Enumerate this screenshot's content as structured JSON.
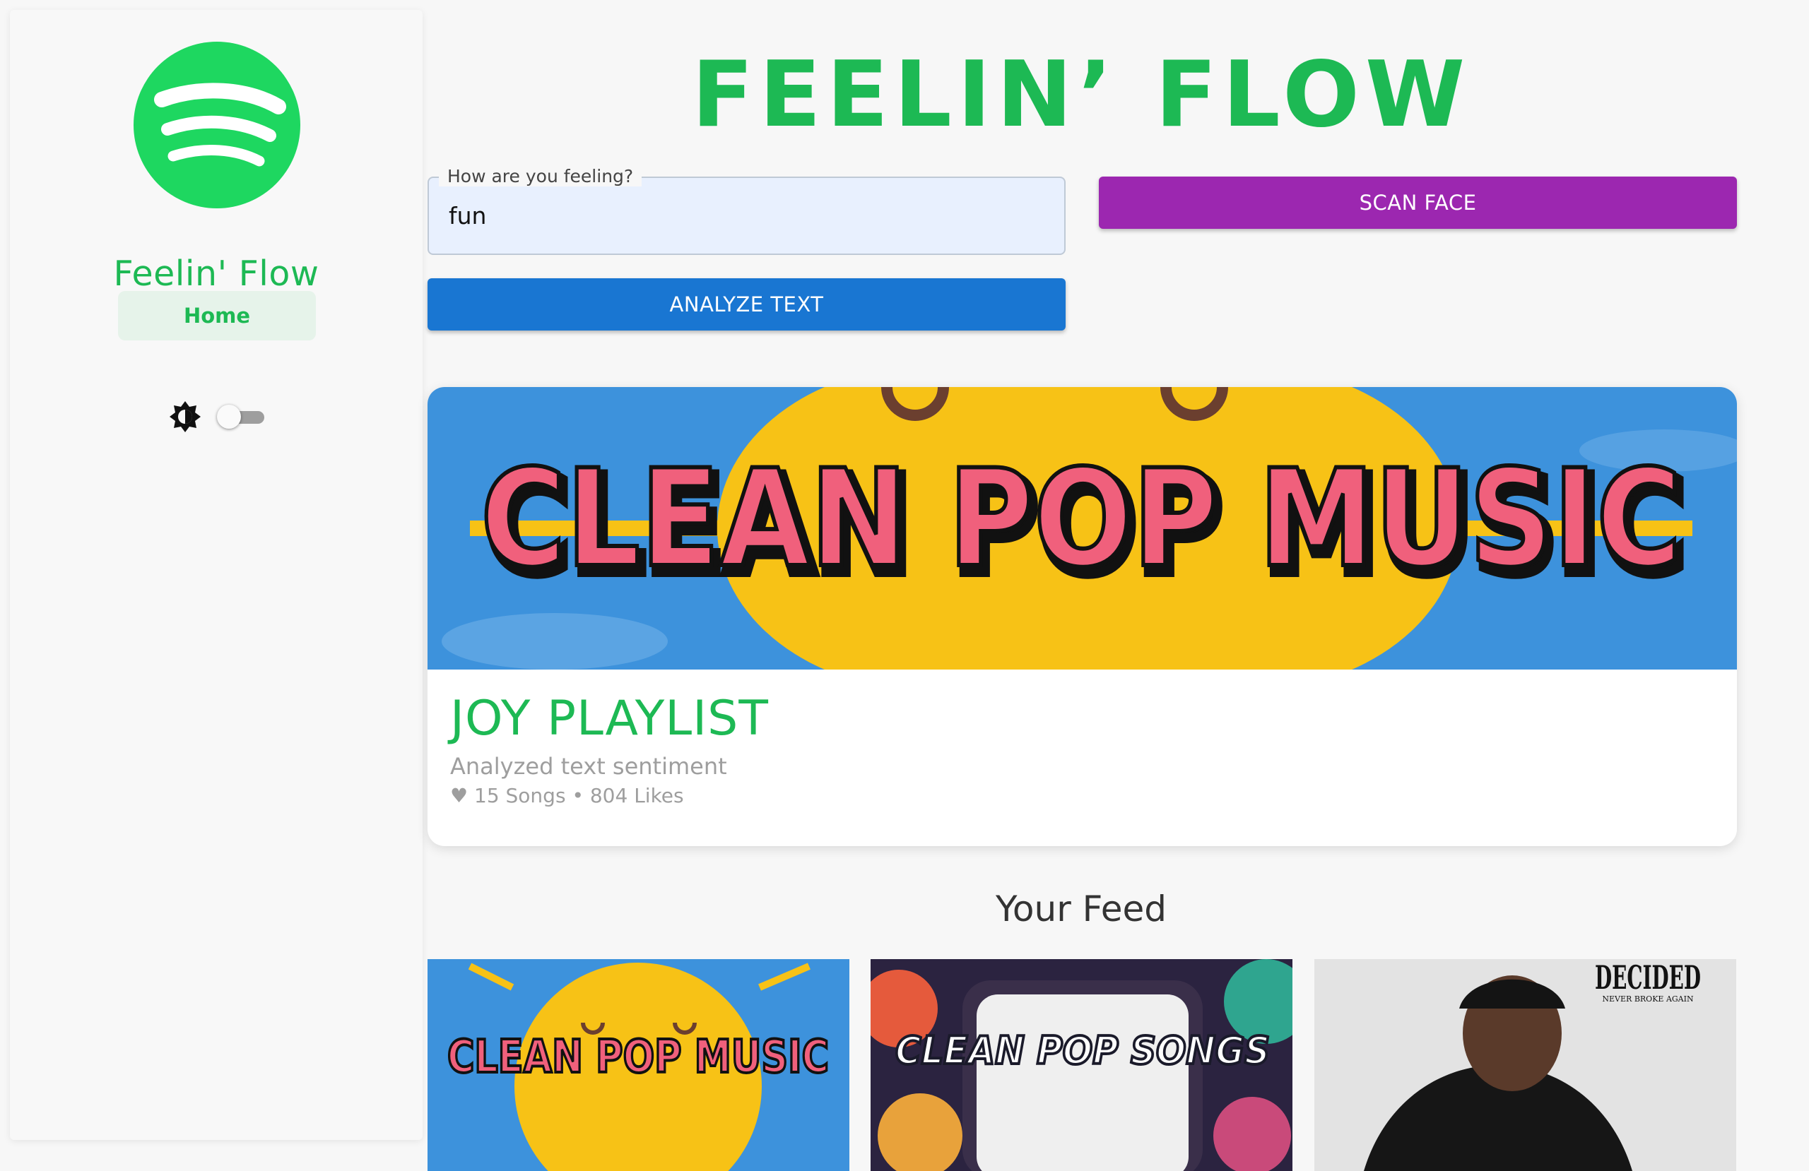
{
  "sidebar": {
    "app_name": "Feelin' Flow",
    "nav": [
      {
        "label": "Home",
        "active": true
      }
    ],
    "theme_toggle": {
      "icon": "brightness-icon",
      "enabled": false
    }
  },
  "header": {
    "title": "FEELIN’ FLOW"
  },
  "mood_form": {
    "field_label": "How are you feeling?",
    "field_value": "fun",
    "analyze_label": "ANALYZE TEXT",
    "scan_label": "SCAN FACE"
  },
  "playlist_card": {
    "banner_text": "CLEAN POP MUSIC",
    "title": "JOY PLAYLIST",
    "subtitle": "Analyzed text sentiment",
    "meta": "♥ 15 Songs • 804 Likes"
  },
  "feed": {
    "title": "Your Feed",
    "items": [
      {
        "art_text": "CLEAN POP MUSIC"
      },
      {
        "art_text": "CLEAN POP SONGS"
      },
      {
        "art_text": "DECIDED",
        "art_subtext": "NEVER BROKE AGAIN"
      }
    ]
  },
  "colors": {
    "brand": "#1DB954",
    "scan_button": "#9c27b0",
    "analyze_button": "#1976d2",
    "field_bg": "#e8f0fe",
    "banner_sky": "#3d92dc",
    "banner_sun": "#f7c216",
    "banner_text": "#f0607c"
  }
}
